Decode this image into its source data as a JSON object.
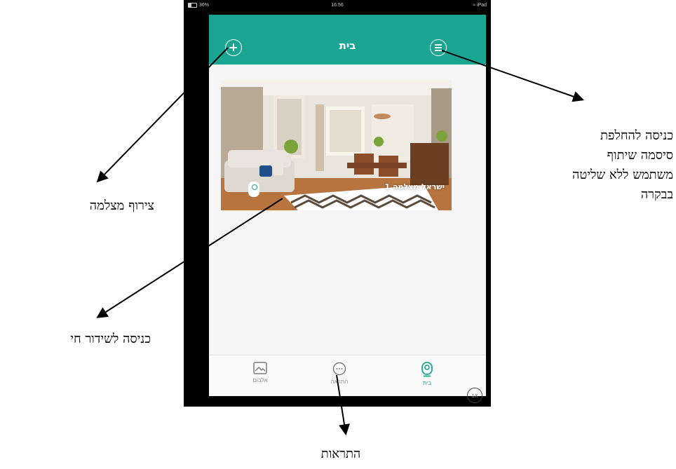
{
  "status_bar": {
    "battery": "36%",
    "time": "16:56",
    "device": "iPad"
  },
  "navbar": {
    "title": "בית",
    "add_icon": "plus-circle-icon",
    "menu_icon": "menu-circle-icon"
  },
  "camera": {
    "name": "ישראל מצלמה 1"
  },
  "tabs": [
    {
      "label": "אלבום",
      "icon": "album-icon"
    },
    {
      "label": "התראה",
      "icon": "notification-icon"
    },
    {
      "label": "בית",
      "icon": "camera-home-icon",
      "active": true
    }
  ],
  "zoom_label": "1X",
  "annotations": {
    "password": [
      "כניסה להחלפת",
      "סיסמה שיתוף",
      "משתמש ללא שליטה",
      "בבקרה"
    ],
    "add_camera": "צירוף מצלמה",
    "live": "כניסה לשידור חי",
    "alerts": "התראות"
  },
  "colors": {
    "accent": "#1aa593",
    "screen_bg": "#f6f5f5",
    "device": "#000000"
  }
}
